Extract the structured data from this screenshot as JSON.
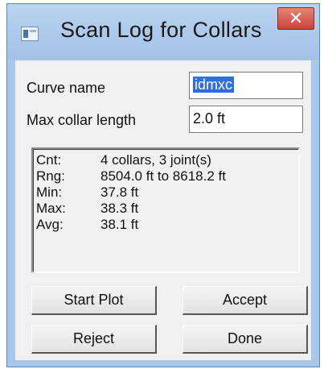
{
  "window": {
    "title": "Scan Log for Collars",
    "close_symbol": "✕",
    "icon": "app-window-icon"
  },
  "fields": {
    "curve_name_label": "Curve name",
    "curve_name_value": "idmxc",
    "max_collar_length_label": "Max collar length",
    "max_collar_length_value": "2.0 ft"
  },
  "stats": {
    "rows": [
      {
        "key": "Cnt:",
        "value": "4 collars, 3 joint(s)"
      },
      {
        "key": "Rng:",
        "value": "8504.0 ft to 8618.2 ft"
      },
      {
        "key": "Min:",
        "value": "37.8 ft"
      },
      {
        "key": "Max:",
        "value": "38.3 ft"
      },
      {
        "key": "Avg:",
        "value": "38.1 ft"
      }
    ]
  },
  "buttons": {
    "start_plot": "Start Plot",
    "accept": "Accept",
    "reject": "Reject",
    "done": "Done"
  },
  "colors": {
    "titlebar": "#a9c7e8",
    "close": "#c9433a",
    "selection": "#2f6fe0"
  }
}
